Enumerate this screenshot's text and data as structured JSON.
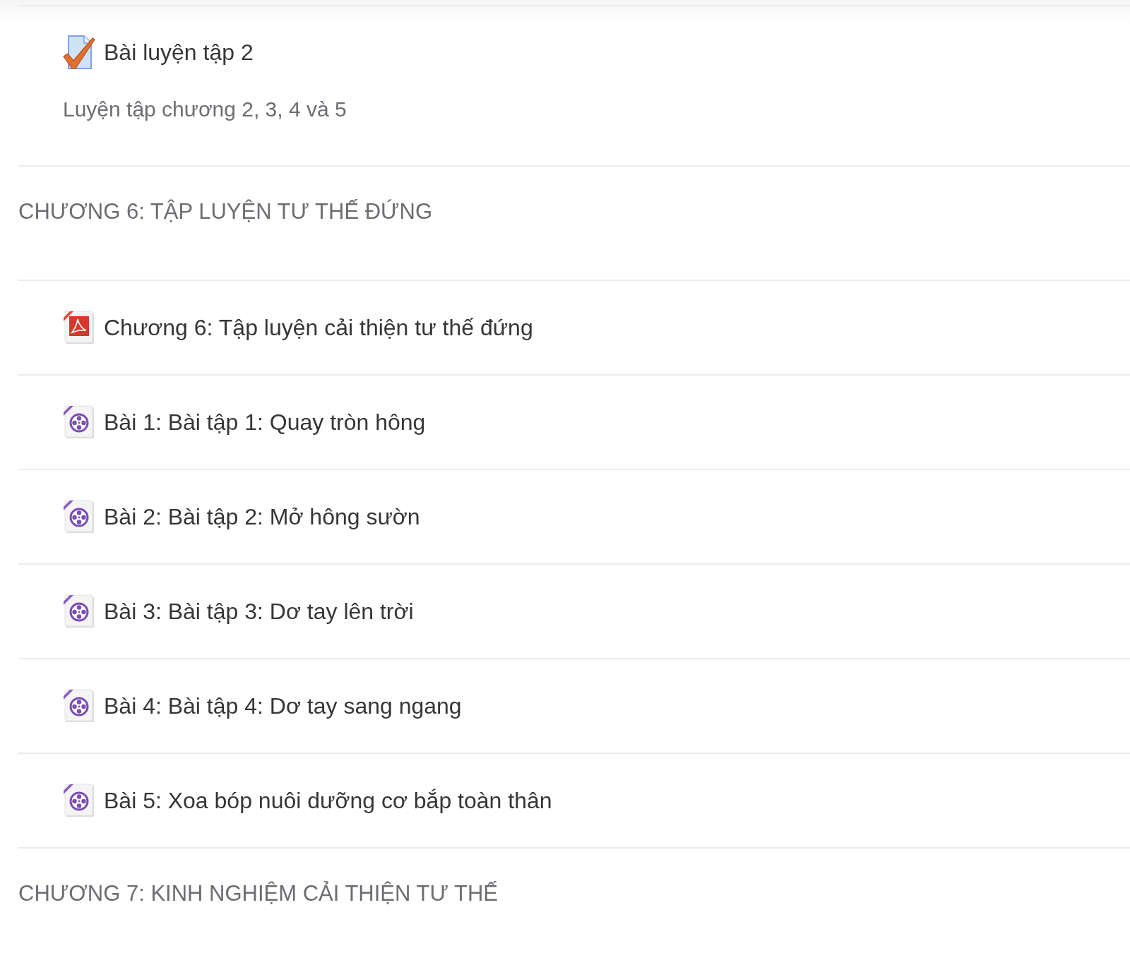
{
  "sections": [
    {
      "items": [
        {
          "kind": "quiz",
          "title": "Bài luyện tập 2",
          "description": "Luyện tập chương 2, 3, 4 và 5"
        }
      ]
    },
    {
      "title": "CHƯƠNG 6: TẬP LUYỆN TƯ THẾ ĐỨNG",
      "items": [
        {
          "kind": "pdf",
          "title": "Chương 6: Tập luyện cải thiện tư thế đứng"
        },
        {
          "kind": "video",
          "title": "Bài 1: Bài tập 1: Quay tròn hông"
        },
        {
          "kind": "video",
          "title": "Bài 2: Bài tập 2: Mở hông sườn"
        },
        {
          "kind": "video",
          "title": "Bài 3: Bài tập 3: Dơ tay lên trời"
        },
        {
          "kind": "video",
          "title": "Bài 4: Bài tập 4: Dơ tay sang ngang"
        },
        {
          "kind": "video",
          "title": "Bài 5: Xoa bóp nuôi dưỡng cơ bắp toàn thân"
        }
      ]
    },
    {
      "title": "CHƯƠNG 7: KINH NGHIỆM CẢI THIỆN TƯ THẾ"
    }
  ]
}
